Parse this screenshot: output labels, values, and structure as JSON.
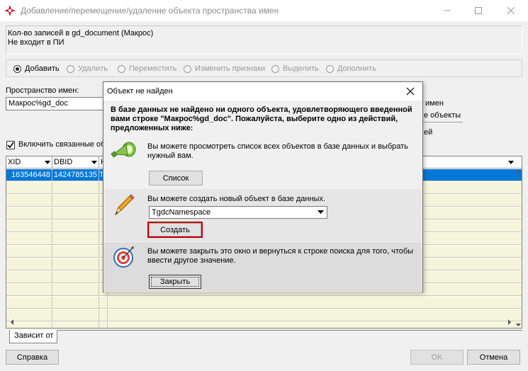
{
  "window": {
    "title": "Добавление/перемещение/удаление объекта пространства имен"
  },
  "info": {
    "line1": "Кол-во записей в gd_document (Макрос)",
    "line2": "Не входит в ПИ"
  },
  "radios": [
    {
      "label": "Добавить",
      "checked": true
    },
    {
      "label": "Удалить",
      "checked": false
    },
    {
      "label": "Переместить",
      "checked": false
    },
    {
      "label": "Изменить признаки",
      "checked": false
    },
    {
      "label": "Выделить",
      "checked": false
    },
    {
      "label": "Дополнить",
      "checked": false
    }
  ],
  "namespace": {
    "label": "Пространство имен:",
    "value": "Макрос%gd_doc"
  },
  "behind_dialog": {
    "partial1": "имен",
    "partial2": "е объекты",
    "partial3": "ей"
  },
  "include_related": {
    "label": "Включить связанные об",
    "checked": true
  },
  "grid": {
    "columns": [
      "XID",
      "DBID",
      "К"
    ],
    "selected_row": [
      "163546448",
      "1424785135",
      "T"
    ]
  },
  "tab": {
    "label": "Зависит от"
  },
  "buttons": {
    "help": "Справка",
    "ok": "OK",
    "cancel": "Отмена"
  },
  "dialog": {
    "title": "Объект не найден",
    "heading": "В базе данных не найдено ни одного объекта, удовлетворяющего введенной вами строке \"Макрос%gd_doc\". Пожалуйста, выберите одно из действий, предложенных ниже:",
    "list_text": "Вы можете просмотреть список всех объектов в базе данных и выбрать нужный вам.",
    "list_button": "Список",
    "create_text": "Вы можете создать новый объект в базе данных.",
    "create_class": "TgdcNamespace",
    "create_button": "Создать",
    "close_text": "Вы можете закрыть это окно и вернуться к строке поиска для того, чтобы ввести другое значение.",
    "close_button": "Закрыть"
  },
  "colors": {
    "selection": "#0078d7",
    "grid_row": "#f5f5dc",
    "highlight_border": "#c00000"
  }
}
